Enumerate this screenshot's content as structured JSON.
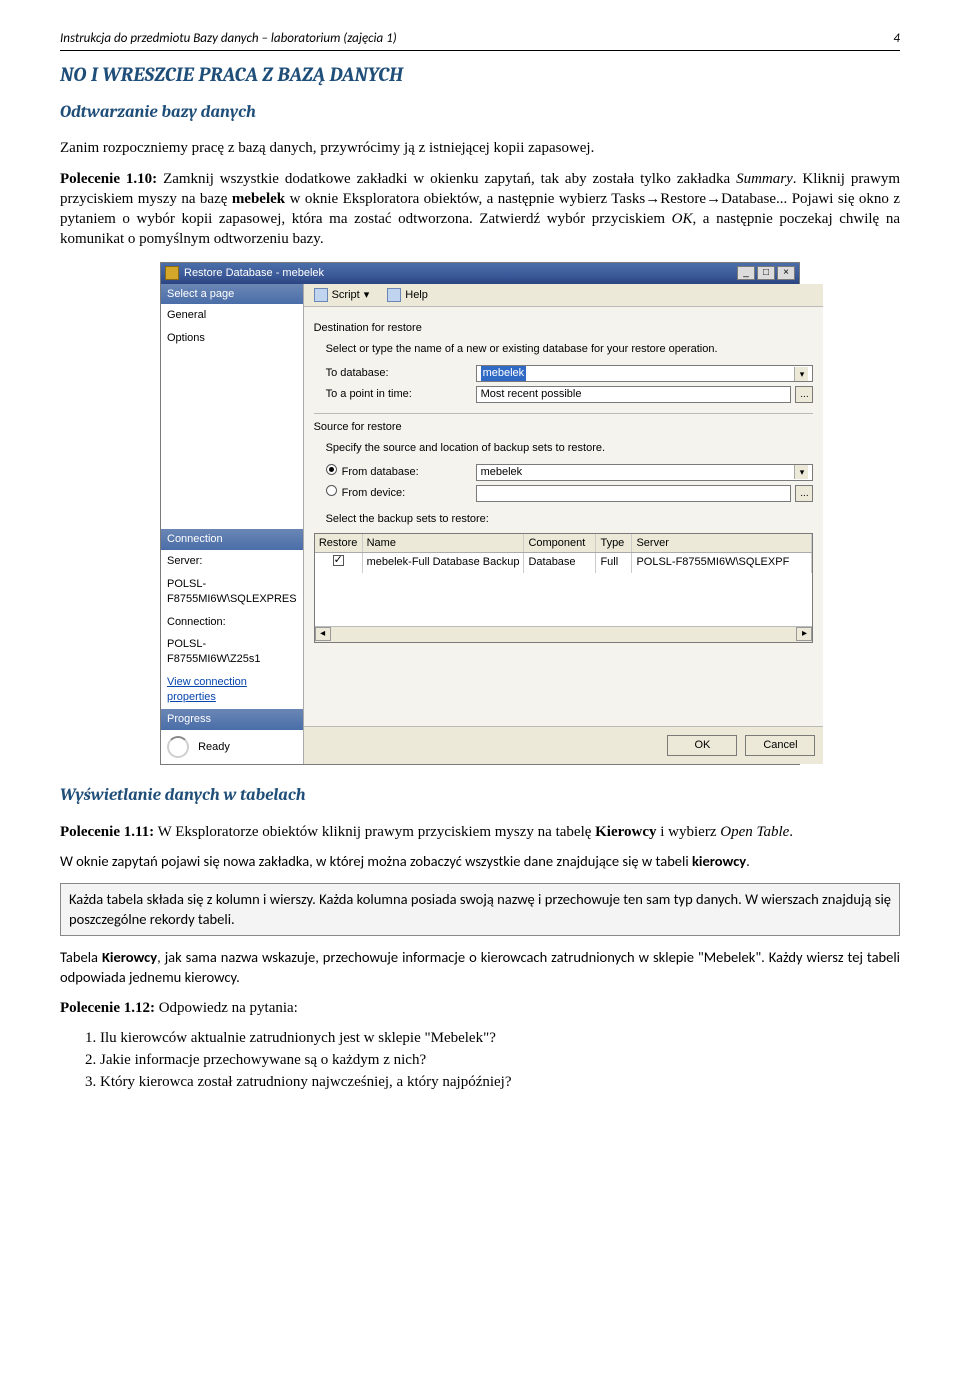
{
  "header": {
    "left": "Instrukcja do przedmiotu Bazy danych – laboratorium (zajęcia 1)",
    "page": "4"
  },
  "s1": {
    "h1": "NO I WRESZCIE PRACA Z BAZĄ DANYCH",
    "h2": "Odtwarzanie bazy danych",
    "p1": "Zanim rozpoczniemy pracę z bazą danych, przywrócimy ją z istniejącej kopii zapasowej.",
    "p2a": "Polecenie 1.10:",
    "p2b": " Zamknij wszystkie dodatkowe zakładki w okienku zapytań, tak aby została tylko zakładka ",
    "p2c": "Summary",
    "p2d": ". Kliknij prawym przyciskiem myszy na bazę ",
    "p2e": "mebelek",
    "p2f": " w oknie Eksploratora obiektów, a następnie wybierz Tasks→Restore→Database... Pojawi się okno z pytaniem o wybór kopii zapasowej, która ma zostać odtworzona. Zatwierdź wybór przyciskiem ",
    "p2g": "OK",
    "p2h": ", a następnie poczekaj chwilę na komunikat o pomyślnym odtworzeniu bazy."
  },
  "shot": {
    "title": "Restore Database - mebelek",
    "win": {
      "min": "_",
      "max": "□",
      "close": "×"
    },
    "left": {
      "hdr1": "Select a page",
      "items": [
        "General",
        "Options"
      ],
      "hdr2": "Connection",
      "server_lbl": "Server:",
      "server_val": "POLSL-F8755MI6W\\SQLEXPRES",
      "conn_lbl": "Connection:",
      "conn_val": "POLSL-F8755MI6W\\Z25s1",
      "link": "View connection properties",
      "hdr3": "Progress",
      "ready": "Ready"
    },
    "tb": {
      "script": "Script",
      "help": "Help",
      "dd": "▾"
    },
    "dest": {
      "title": "Destination for restore",
      "hint": "Select or type the name of a new or existing database for your restore operation.",
      "todb_lbl": "To database:",
      "todb_val": "mebelek",
      "pit_lbl": "To a point in time:",
      "pit_val": "Most recent possible",
      "pit_btn": "..."
    },
    "src": {
      "title": "Source for restore",
      "hint": "Specify the source and location of backup sets to restore.",
      "r1": "From database:",
      "r1v": "mebelek",
      "r2": "From device:",
      "r2btn": "...",
      "sel": "Select the backup sets to restore:"
    },
    "grid": {
      "h": [
        "Restore",
        "Name",
        "Component",
        "Type",
        "Server"
      ],
      "row": {
        "name": "mebelek-Full Database Backup",
        "comp": "Database",
        "type": "Full",
        "server": "POLSL-F8755MI6W\\SQLEXPF"
      },
      "scroll": {
        "l": "◂",
        "r": "▸"
      }
    },
    "btns": {
      "ok": "OK",
      "cancel": "Cancel"
    }
  },
  "s2": {
    "h2": "Wyświetlanie danych w tabelach",
    "p1a": "Polecenie 1.11:",
    "p1b": " W Eksploratorze obiektów kliknij prawym przyciskiem myszy na tabelę ",
    "p1c": "Kierowcy",
    "p1d": " i wybierz ",
    "p1e": "Open Table",
    "p1f": ".",
    "p2a": "W oknie zapytań pojawi się nowa zakładka, w której można zobaczyć wszystkie dane znajdujące się w tabeli ",
    "p2b": "kierowcy",
    "p2c": ".",
    "note": "Każda tabela składa się z kolumn i wierszy. Każda kolumna posiada swoją nazwę i przechowuje ten sam typ danych. W wierszach znajdują się poszczególne rekordy tabeli.",
    "p3a": "Tabela ",
    "p3b": "Kierowcy",
    "p3c": ", jak sama nazwa wskazuje, przechowuje informacje o kierowcach zatrudnionych w sklepie \"Mebelek\". Każdy wiersz tej tabeli odpowiada jednemu kierowcy.",
    "p4a": "Polecenie 1.12:",
    "p4b": " Odpowiedz na pytania:",
    "q": [
      "Ilu kierowców aktualnie zatrudnionych jest w sklepie \"Mebelek\"?",
      "Jakie informacje przechowywane są o każdym z nich?",
      "Który kierowca został zatrudniony najwcześniej, a który najpóźniej?"
    ]
  }
}
